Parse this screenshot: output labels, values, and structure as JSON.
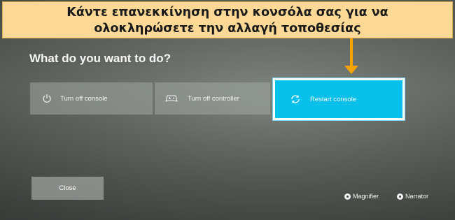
{
  "banner": {
    "line1": "Κάντε επανεκκίνηση στην κονσόλα σας για να",
    "line2": "ολοκληρώσετε την αλλαγή τοποθεσίας"
  },
  "dialog": {
    "heading": "What do you want to do?",
    "options": [
      {
        "label": "Turn off console",
        "icon": "power-icon"
      },
      {
        "label": "Turn off controller",
        "icon": "controller-icon"
      },
      {
        "label": "Restart console",
        "icon": "restart-icon",
        "selected": true
      }
    ],
    "close_label": "Close"
  },
  "accessibility": {
    "magnifier_label": "Magnifier",
    "narrator_label": "Narrator"
  },
  "colors": {
    "banner_bg": "#fcd896",
    "arrow": "#f5a300",
    "selected": "#08c0ea"
  }
}
